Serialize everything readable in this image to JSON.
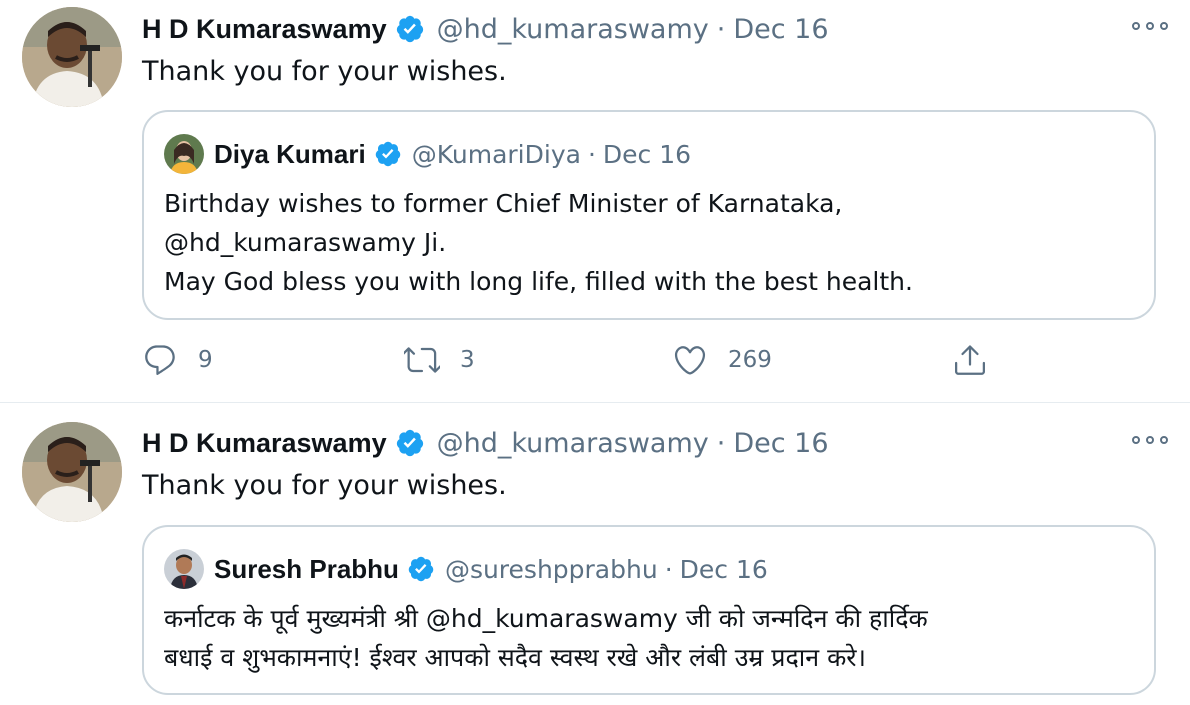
{
  "tweets": [
    {
      "author": {
        "name": "H D Kumaraswamy",
        "handle": "@hd_kumaraswamy",
        "avatar_icon": "profile-photo"
      },
      "dot": "·",
      "date": "Dec 16",
      "text": "Thank you for your wishes.",
      "quote": {
        "author": {
          "name": "Diya Kumari",
          "handle": "@KumariDiya"
        },
        "dot": "·",
        "date": "Dec 16",
        "lines": [
          "Birthday wishes to former Chief Minister of Karnataka,",
          "@hd_kumaraswamy Ji.",
          "May God bless you with long life, filled with the best health."
        ]
      },
      "actions": {
        "replies": "9",
        "retweets": "3",
        "likes": "269"
      }
    },
    {
      "author": {
        "name": "H D Kumaraswamy",
        "handle": "@hd_kumaraswamy",
        "avatar_icon": "profile-photo"
      },
      "dot": "·",
      "date": "Dec 16",
      "text": "Thank you for your wishes.",
      "quote": {
        "author": {
          "name": "Suresh Prabhu",
          "handle": "@sureshpprabhu"
        },
        "dot": "·",
        "date": "Dec 16",
        "lines": [
          "कर्नाटक के पूर्व मुख्यमंत्री श्री @hd_kumaraswamy जी को जन्मदिन की हार्दिक",
          "बधाई व शुभकामनाएं! ईश्वर आपको सदैव स्वस्थ रखे और लंबी उम्र प्रदान करे।"
        ]
      }
    }
  ],
  "colors": {
    "verified": "#1da1f2",
    "secondary_text": "#5b7083",
    "border": "#ccd6dd"
  }
}
